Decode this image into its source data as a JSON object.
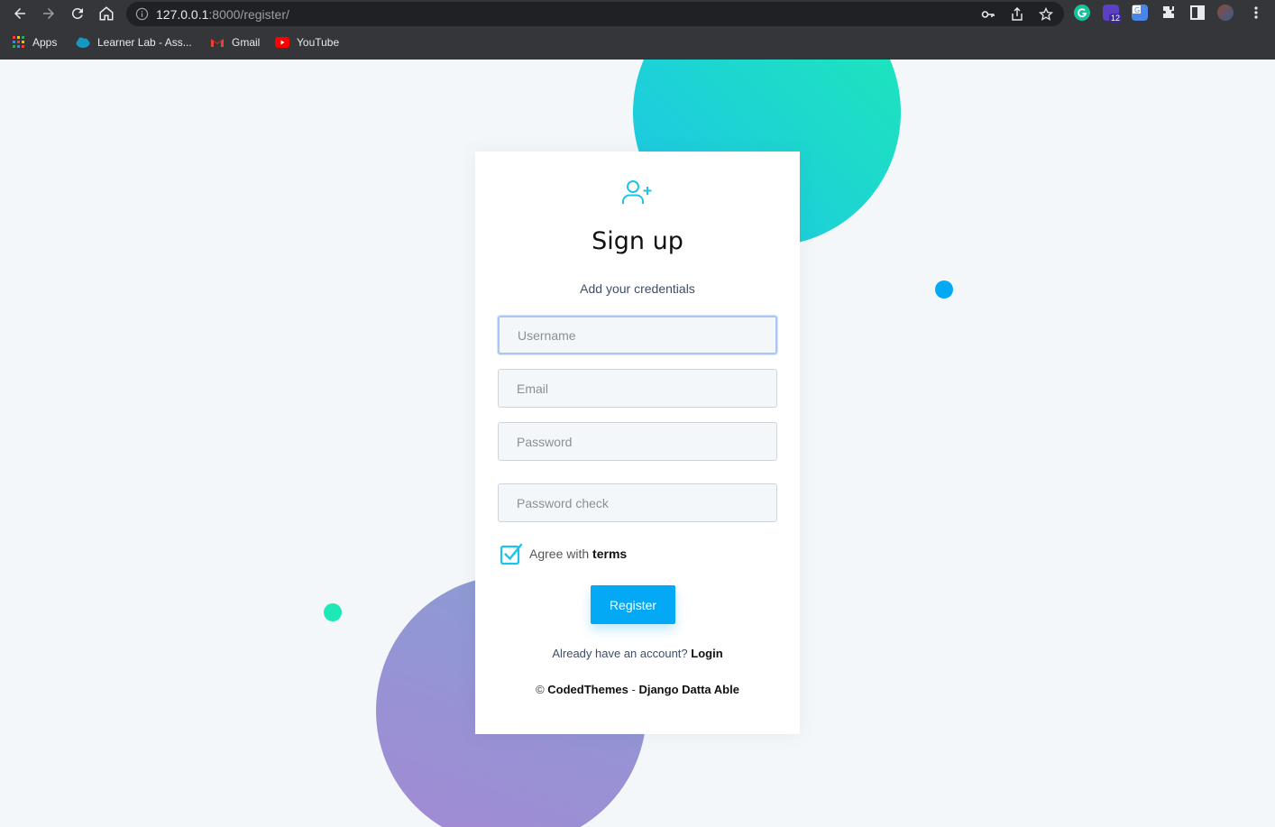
{
  "browser": {
    "url_host": "127.0.0.1",
    "url_rest": ":8000/register/",
    "extension_badge": "12",
    "bookmarks": [
      {
        "label": "Apps",
        "icon": "apps-grid-icon"
      },
      {
        "label": "Learner Lab - Ass...",
        "icon": "salesforce-cloud-icon"
      },
      {
        "label": "Gmail",
        "icon": "gmail-icon"
      },
      {
        "label": "YouTube",
        "icon": "youtube-icon"
      }
    ]
  },
  "signup": {
    "title": "Sign up",
    "subtitle": "Add your credentials",
    "username_placeholder": "Username",
    "email_placeholder": "Email",
    "password_placeholder": "Password",
    "password_check_placeholder": "Password check",
    "agree_prefix": "Agree with",
    "agree_link": "terms",
    "agree_checked": true,
    "register_label": "Register",
    "account_prompt": "Already have an account?",
    "login_link": "Login",
    "footer_copyright": "©",
    "footer_brand": "CodedThemes",
    "footer_separator": "-",
    "footer_product": "Django Datta Able"
  },
  "colors": {
    "accent_blue": "#04a9f5",
    "accent_teal": "#1de9b6",
    "page_bg": "#f4f7fa"
  }
}
